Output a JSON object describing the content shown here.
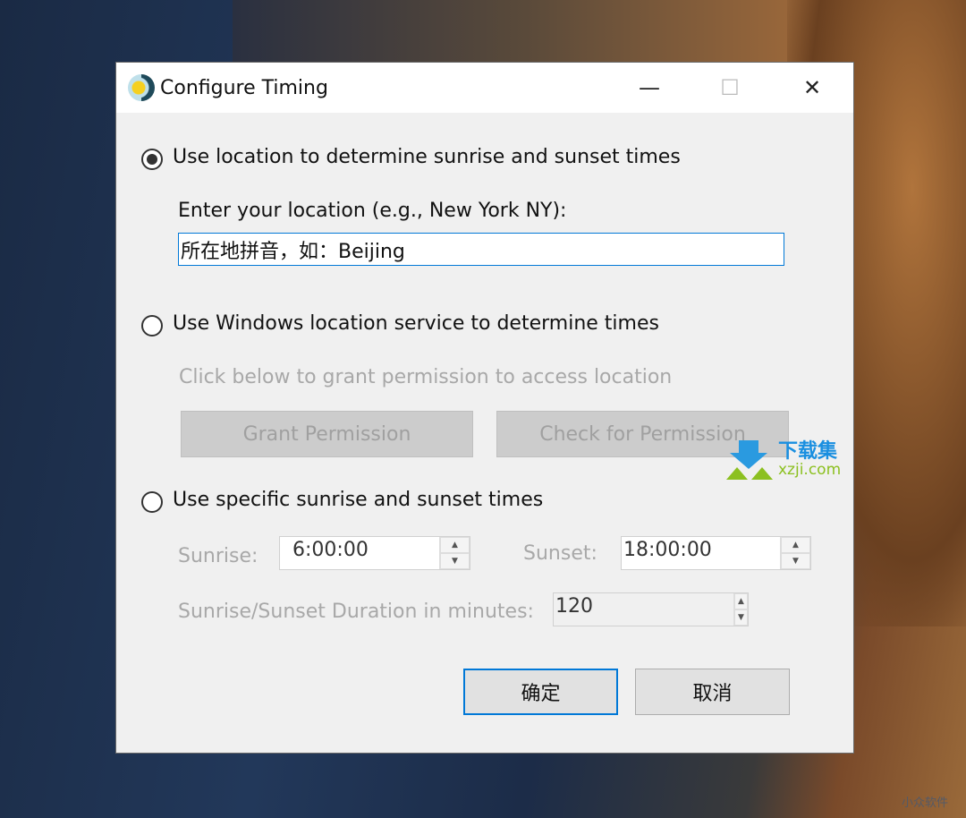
{
  "window": {
    "title": "Configure Timing",
    "minimize": "—",
    "maximize": "☐",
    "close": "✕"
  },
  "option_location": {
    "label": "Use location to determine sunrise and sunset times",
    "selected": true,
    "prompt": "Enter your location (e.g., New York NY):",
    "value": "所在地拼音，如：Beijing"
  },
  "option_windows": {
    "label": "Use Windows location service to determine times",
    "selected": false,
    "hint": "Click below to grant permission to access location",
    "grant": "Grant Permission",
    "check": "Check for Permission"
  },
  "option_specific": {
    "label": "Use specific sunrise and sunset times",
    "selected": false,
    "sunrise_label": "Sunrise:",
    "sunrise": "6:00:00",
    "sunset_label": "Sunset:",
    "sunset": "18:00:00",
    "duration_label": "Sunrise/Sunset Duration in minutes:",
    "duration": "120"
  },
  "buttons": {
    "ok": "确定",
    "cancel": "取消"
  },
  "watermarks": {
    "site_name": "下载集",
    "site_url": "xzji.com",
    "corner": "小众软件"
  }
}
